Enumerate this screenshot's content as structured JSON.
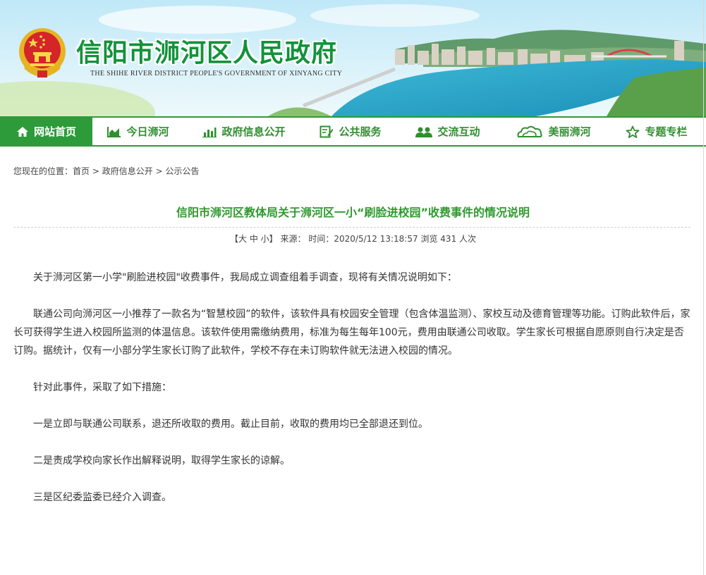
{
  "header": {
    "title": "信阳市浉河区人民政府",
    "subtitle": "THE SHIHE RIVER DISTRICT PEOPLE'S GOVERNMENT OF XINYANG CITY"
  },
  "nav": {
    "items": [
      {
        "label": "网站首页",
        "icon": "home-icon",
        "active": true
      },
      {
        "label": "今日浉河",
        "icon": "area-chart-icon"
      },
      {
        "label": "政府信息公开",
        "icon": "bar-chart-icon"
      },
      {
        "label": "公共服务",
        "icon": "document-edit-icon"
      },
      {
        "label": "交流互动",
        "icon": "users-icon"
      },
      {
        "label": "美丽浉河",
        "icon": "cloud-icon"
      },
      {
        "label": "专题专栏",
        "icon": "star-icon"
      }
    ]
  },
  "breadcrumb": {
    "prefix": "您现在的位置：",
    "items": [
      "首页",
      "政府信息公开",
      "公示公告"
    ],
    "separator": ">"
  },
  "article": {
    "title": "信阳市浉河区教体局关于浉河区一小“刷脸进校园”收费事件的情况说明",
    "meta": {
      "bracket_open": "【",
      "font_large": "大",
      "font_medium": "中",
      "font_small": "小",
      "bracket_close": "】",
      "source_label": "来源：",
      "time_label": "时间：",
      "time": "2020/5/12 13:18:57",
      "views_label": "浏览",
      "views": "431",
      "views_unit": "人次"
    },
    "paragraphs": [
      "关于浉河区第一小学\"刷脸进校园\"收费事件，我局成立调查组着手调查，现将有关情况说明如下：",
      "联通公司向浉河区一小推荐了一款名为“智慧校园”的软件，该软件具有校园安全管理（包含体温监测）、家校互动及德育管理等功能。订购此软件后，家长可获得学生进入校园所监测的体温信息。该软件使用需缴纳费用，标准为每生每年100元，费用由联通公司收取。学生家长可根据自愿原则自行决定是否订购。据统计，仅有一小部分学生家长订购了此软件，学校不存在未订购软件就无法进入校园的情况。",
      "针对此事件，采取了如下措施：",
      "一是立即与联通公司联系，退还所收取的费用。截止目前，收取的费用均已全部退还到位。",
      "二是责成学校向家长作出解释说明，取得学生家长的谅解。",
      "三是区纪委监委已经介入调查。"
    ]
  },
  "colors": {
    "brand_green": "#2d9b3a",
    "title_green": "#12923a",
    "article_title_green": "#2e9a2e"
  }
}
